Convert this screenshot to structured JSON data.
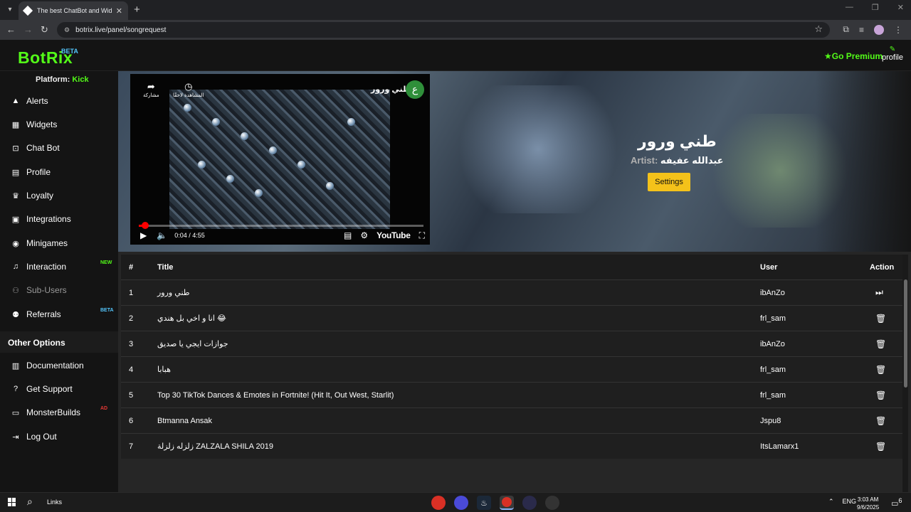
{
  "browser": {
    "tab_title": "The best ChatBot and Widgets",
    "url": "botrix.live/panel/songrequest"
  },
  "header": {
    "logo": "BotRix",
    "beta": "BETA",
    "go_premium": "Go Premium",
    "profile": "profile"
  },
  "sidebar": {
    "platform_label": "Platform:",
    "platform_value": "Kick",
    "items": [
      {
        "label": "Alerts",
        "icon": "warning-icon"
      },
      {
        "label": "Widgets",
        "icon": "grid-icon"
      },
      {
        "label": "Chat Bot",
        "icon": "robot-icon"
      },
      {
        "label": "Profile",
        "icon": "id-card-icon"
      },
      {
        "label": "Loyalty",
        "icon": "trophy-icon"
      },
      {
        "label": "Integrations",
        "icon": "puzzle-icon"
      },
      {
        "label": "Minigames",
        "icon": "gamepad-icon"
      },
      {
        "label": "Interaction",
        "icon": "music-icon",
        "badge": "NEW"
      },
      {
        "label": "Sub-Users",
        "icon": "users-icon"
      },
      {
        "label": "Referrals",
        "icon": "user-plus-icon",
        "badge": "BETA"
      }
    ],
    "other_heading": "Other Options",
    "other_items": [
      {
        "label": "Documentation",
        "icon": "book-icon"
      },
      {
        "label": "Get Support",
        "icon": "question-icon"
      },
      {
        "label": "MonsterBuilds",
        "icon": "laptop-icon",
        "badge": "AD"
      },
      {
        "label": "Log Out",
        "icon": "logout-icon"
      }
    ],
    "badge_colors": {
      "new": "#53fc18",
      "beta": "#53c6fc",
      "ad": "#e53935"
    }
  },
  "player": {
    "video_title": "طني ورور",
    "channel_initial": "ع",
    "share_label": "مشاركة",
    "watch_later_label": "المشاهدة لاحقًا",
    "time": "0:04 / 4:55",
    "progress": 0.014,
    "youtube": "YouTube"
  },
  "now_playing": {
    "title": "طني ورور",
    "artist_label": "Artist:",
    "artist": "عبدالله عفيفه",
    "settings_label": "Settings"
  },
  "table": {
    "headers": {
      "num": "#",
      "title": "Title",
      "user": "User",
      "action": "Action"
    },
    "rows": [
      {
        "num": "1",
        "title": "طني ورور",
        "user": "ibAnZo",
        "action": "skip-icon"
      },
      {
        "num": "2",
        "title": "انا و اخي بل هندي 😂",
        "user": "frl_sam",
        "action": "trash-icon"
      },
      {
        "num": "3",
        "title": "جوازات ايجي يا صديق",
        "user": "ibAnZo",
        "action": "trash-icon"
      },
      {
        "num": "4",
        "title": "هبابا",
        "user": "frl_sam",
        "action": "trash-icon"
      },
      {
        "num": "5",
        "title": "Top 30 TikTok Dances & Emotes in Fortnite! (Hit It, Out West, Starlit)",
        "user": "frl_sam",
        "action": "trash-icon"
      },
      {
        "num": "6",
        "title": "Btmanna Ansak",
        "user": "Jspu8",
        "action": "trash-icon"
      },
      {
        "num": "7",
        "title": "زلزله زلزلة ZALZALA SHILA 2019",
        "user": "ItsLamarx1",
        "action": "trash-icon"
      }
    ]
  },
  "taskbar": {
    "links": "Links",
    "lang": "ENG",
    "time": "3:03 AM",
    "date": "9/6/2025",
    "notif_count": "6"
  },
  "colors": {
    "accent": "#53fc18",
    "settings": "#f4c21a"
  }
}
